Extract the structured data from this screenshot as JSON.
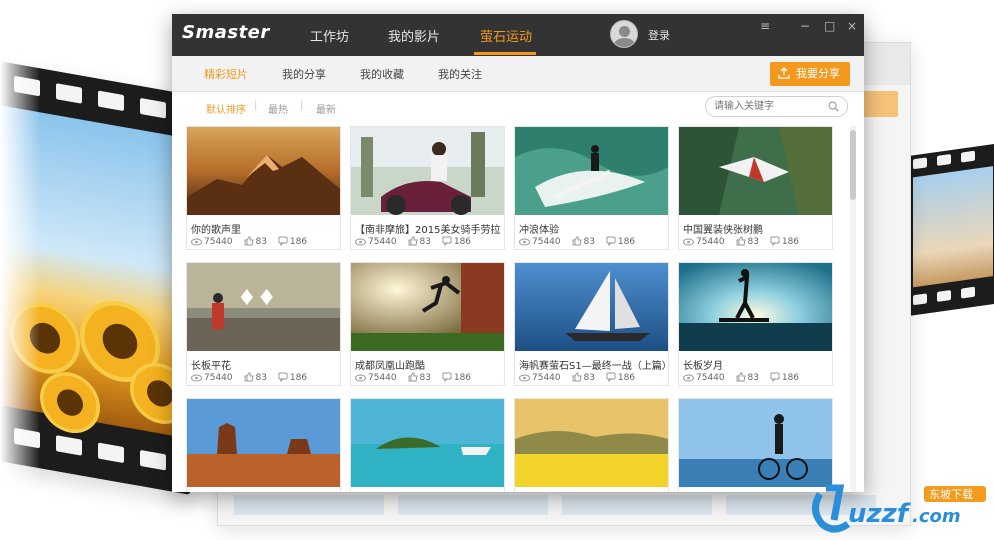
{
  "app": {
    "logo": "Smaster",
    "nav": [
      "工作坊",
      "我的影片",
      "萤石运动"
    ],
    "active_nav": "萤石运动",
    "login": "登录",
    "window_controls": [
      "≡",
      "−",
      "□",
      "×"
    ]
  },
  "subnav": {
    "tabs": [
      "精彩短片",
      "我的分享",
      "我的收藏",
      "我的关注"
    ],
    "active": "精彩短片",
    "share_button": "我要分享"
  },
  "sort": {
    "options": [
      "默认排序",
      "最热",
      "最新"
    ],
    "active": "默认排序",
    "separator": "|",
    "search_placeholder": "请输入关键字"
  },
  "videos": [
    {
      "title": "你的歌声里",
      "views": "75440",
      "likes": "83",
      "comments": "186",
      "scene": "mountain-sunset"
    },
    {
      "title": "【南非摩旅】2015美女骑手劳拉...",
      "views": "75440",
      "likes": "83",
      "comments": "186",
      "scene": "motorbike"
    },
    {
      "title": "冲浪体验",
      "views": "75440",
      "likes": "83",
      "comments": "186",
      "scene": "surf"
    },
    {
      "title": "中国翼装侠张树鹏",
      "views": "75440",
      "likes": "83",
      "comments": "186",
      "scene": "wingsuit"
    },
    {
      "title": "长板平花",
      "views": "75440",
      "likes": "83",
      "comments": "186",
      "scene": "longboard"
    },
    {
      "title": "成都凤凰山跑酷",
      "views": "75440",
      "likes": "83",
      "comments": "186",
      "scene": "parkour"
    },
    {
      "title": "海帆赛萤石S1—最终一战（上篇）",
      "views": "75440",
      "likes": "83",
      "comments": "186",
      "scene": "sailing"
    },
    {
      "title": "长板岁月",
      "views": "75440",
      "likes": "83",
      "comments": "186",
      "scene": "skate-sunset"
    },
    {
      "title": "",
      "views": "",
      "likes": "",
      "comments": "",
      "scene": "desert"
    },
    {
      "title": "",
      "views": "",
      "likes": "",
      "comments": "",
      "scene": "island"
    },
    {
      "title": "",
      "views": "",
      "likes": "",
      "comments": "",
      "scene": "flower-field"
    },
    {
      "title": "",
      "views": "",
      "likes": "",
      "comments": "",
      "scene": "cyclist"
    }
  ],
  "watermark": {
    "brand": "uzzf.com",
    "tag": "东坡下载"
  },
  "colors": {
    "accent": "#f39a1e",
    "titlebar": "#333333",
    "subnav_bg": "#f2f2f2"
  },
  "icons": [
    "menu-icon",
    "minimize-icon",
    "maximize-icon",
    "close-icon",
    "upload-icon",
    "search-icon",
    "eye-icon",
    "thumb-up-icon",
    "comment-icon",
    "avatar-icon"
  ]
}
